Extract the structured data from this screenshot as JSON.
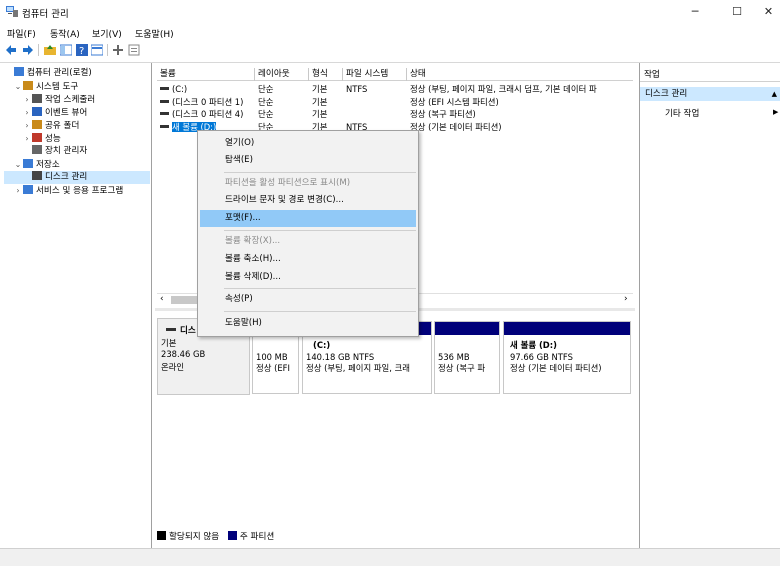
{
  "window": {
    "title": "컴퓨터 관리",
    "minimize": "─",
    "maximize": "☐",
    "close": "✕"
  },
  "menu": [
    "파일(F)",
    "동작(A)",
    "보기(V)",
    "도움말(H)"
  ],
  "tree": [
    {
      "label": "컴퓨터 관리(로컬)",
      "arrow": "",
      "icon": "computer-management-icon",
      "indent": 0
    },
    {
      "label": "시스템 도구",
      "arrow": "⌄",
      "icon": "system-tools-icon",
      "indent": 1
    },
    {
      "label": "작업 스케줄러",
      "arrow": "›",
      "icon": "task-scheduler-icon",
      "indent": 2
    },
    {
      "label": "이벤트 뷰어",
      "arrow": "›",
      "icon": "event-viewer-icon",
      "indent": 2
    },
    {
      "label": "공유 폴더",
      "arrow": "›",
      "icon": "shared-folders-icon",
      "indent": 2
    },
    {
      "label": "성능",
      "arrow": "›",
      "icon": "performance-icon",
      "indent": 2
    },
    {
      "label": "장치 관리자",
      "arrow": "",
      "icon": "device-manager-icon",
      "indent": 2
    },
    {
      "label": "저장소",
      "arrow": "⌄",
      "icon": "storage-icon",
      "indent": 1
    },
    {
      "label": "디스크 관리",
      "arrow": "",
      "icon": "disk-management-icon",
      "indent": 2,
      "selected": true
    },
    {
      "label": "서비스 및 응용 프로그램",
      "arrow": "›",
      "icon": "services-applications-icon",
      "indent": 1
    }
  ],
  "volumes": {
    "headers": [
      "볼륨",
      "레이아웃",
      "형식",
      "파일 시스템",
      "상태"
    ],
    "rows": [
      {
        "name": "(C:)",
        "layout": "단순",
        "type": "기본",
        "fs": "NTFS",
        "status": "정상 (부팅, 페이지 파일, 크래시 덤프, 기본 데이터 파"
      },
      {
        "name": "(디스크 0 파티션 1)",
        "layout": "단순",
        "type": "기본",
        "fs": "",
        "status": "정상 (EFI 시스템 파티션)"
      },
      {
        "name": "(디스크 0 파티션 4)",
        "layout": "단순",
        "type": "기본",
        "fs": "",
        "status": "정상 (복구 파티션)"
      },
      {
        "name": "새 볼륨 (D:)",
        "layout": "단순",
        "type": "기본",
        "fs": "NTFS",
        "status": "정상 (기본 데이터 파티션)"
      }
    ],
    "scroll_left": "‹",
    "scroll_right": "›"
  },
  "disk": {
    "name": "디스",
    "type": "기본",
    "size": "238.46 GB",
    "state": "온라인",
    "partitions": [
      {
        "title": "",
        "size": "100 MB",
        "status": "정상 (EFI"
      },
      {
        "title": "(C:)",
        "size": "140.18 GB NTFS",
        "status": "정상 (부팅, 페이지 파일, 크래"
      },
      {
        "title": "",
        "size": "536 MB",
        "status": "정상 (복구 파"
      },
      {
        "title": "새 볼륨  (D:)",
        "size": "97.66 GB NTFS",
        "status": "정상 (기본 데이터 파티션)"
      }
    ]
  },
  "legend": {
    "unallocated": "할당되지 않음",
    "primary": "주 파티션"
  },
  "actions": {
    "title": "작업",
    "section": "디스크 관리",
    "other": "기타 작업",
    "section_arrow": "▲",
    "other_arrow": "▶"
  },
  "context_menu": {
    "open": "열기(O)",
    "explore": "탐색(E)",
    "mark_active": "파티션을 활성 파티션으로 표시(M)",
    "change_letter": "드라이브 문자 및 경로 변경(C)...",
    "format": "포맷(F)...",
    "extend": "볼륨 확장(X)...",
    "shrink": "볼륨 축소(H)...",
    "delete": "볼륨 삭제(D)...",
    "properties": "속성(P)",
    "help": "도움말(H)"
  },
  "colors": {
    "primary_partition": "#00007a",
    "unallocated": "#000000",
    "selection": "#cce8ff",
    "menu_highlight": "#91c9f7"
  }
}
